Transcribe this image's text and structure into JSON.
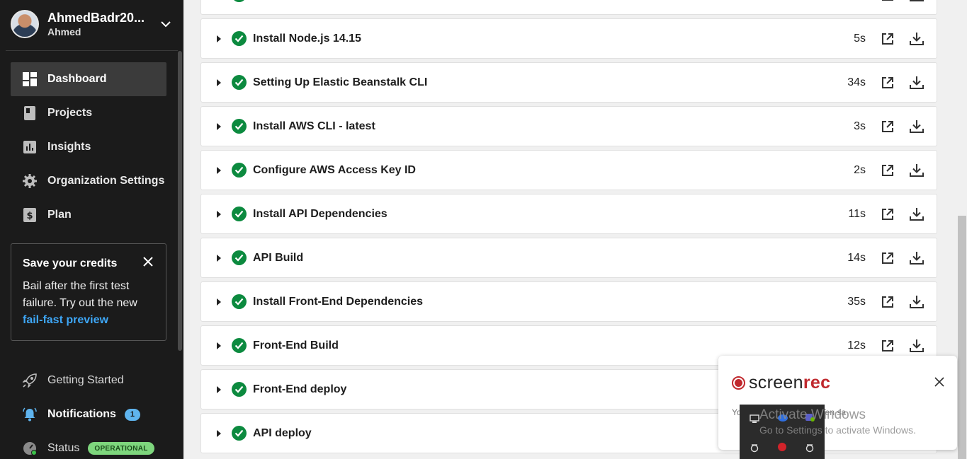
{
  "user": {
    "name": "AhmedBadr20...",
    "subtitle": "Ahmed"
  },
  "nav": [
    {
      "label": "Dashboard",
      "icon": "dashboard-icon"
    },
    {
      "label": "Projects",
      "icon": "projects-icon"
    },
    {
      "label": "Insights",
      "icon": "insights-icon"
    },
    {
      "label": "Organization Settings",
      "icon": "gear-icon"
    },
    {
      "label": "Plan",
      "icon": "dollar-icon"
    }
  ],
  "promo": {
    "title": "Save your credits",
    "body": "Bail after the first test failure. Try out the new",
    "link": "fail-fast preview"
  },
  "bottom_nav": {
    "getting_started": "Getting Started",
    "notifications": "Notifications",
    "notifications_count": "1",
    "status": "Status",
    "status_badge": "OPERATIONAL"
  },
  "steps": [
    {
      "name": "Install Node.js 14.15",
      "duration": "5s"
    },
    {
      "name": "Setting Up Elastic Beanstalk CLI",
      "duration": "34s"
    },
    {
      "name": "Install AWS CLI - latest",
      "duration": "3s"
    },
    {
      "name": "Configure AWS Access Key ID",
      "duration": "2s"
    },
    {
      "name": "Install API Dependencies",
      "duration": "11s"
    },
    {
      "name": "API Build",
      "duration": "14s"
    },
    {
      "name": "Install Front-End Dependencies",
      "duration": "35s"
    },
    {
      "name": "Front-End Build",
      "duration": "12s"
    },
    {
      "name": "Front-End deploy",
      "duration": ""
    },
    {
      "name": "API deploy",
      "duration": ""
    }
  ],
  "screenrec": {
    "brand_a": "screen",
    "brand_b": "rec",
    "message": "Yo 18.14.44.REC has been sa"
  },
  "watermark": {
    "line1": "Activate Windows",
    "line2": "Go to Settings to activate Windows."
  },
  "colors": {
    "sidebar": "#1b1b1b",
    "success": "#0c8a3f",
    "link": "#3ea7f7",
    "brand_red": "#c0282d"
  }
}
